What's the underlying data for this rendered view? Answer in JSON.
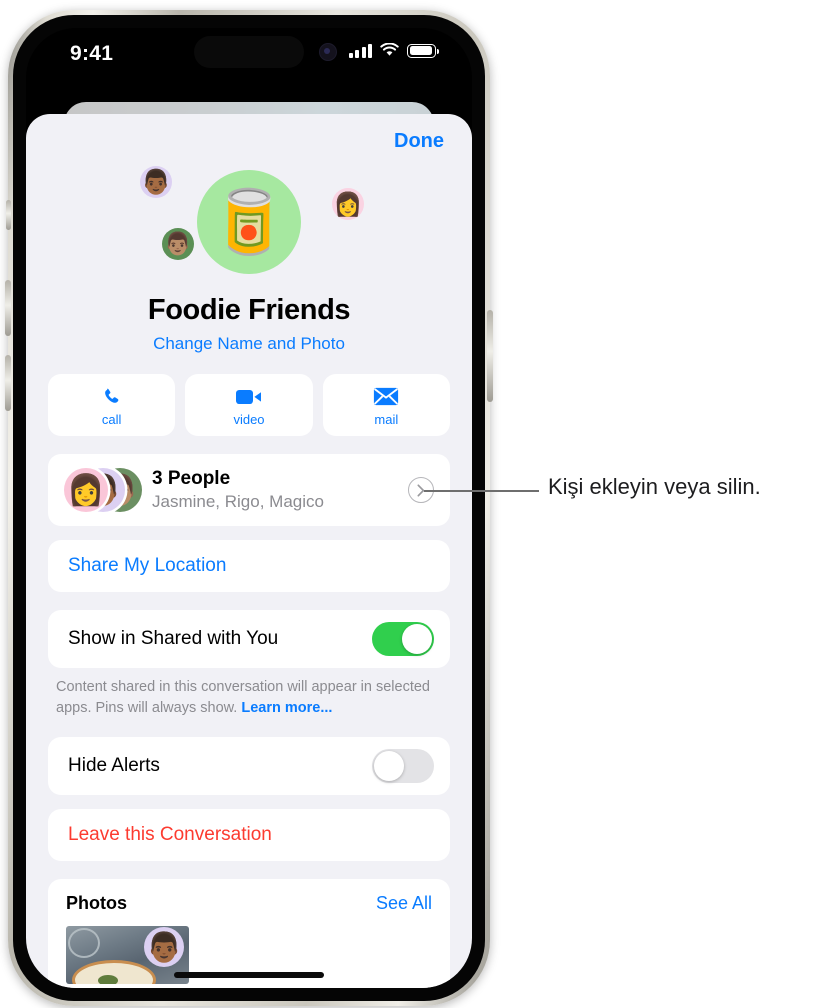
{
  "status_bar": {
    "time": "9:41",
    "cellular_icon": "signal-bars-icon",
    "wifi_icon": "wifi-icon",
    "battery_icon": "battery-icon"
  },
  "sheet": {
    "done_label": "Done",
    "group": {
      "photo_icon": "canned-food-emoji",
      "photo_bg": "#A6E8A0",
      "name": "Foodie Friends",
      "change_link": "Change Name and Photo",
      "member_avatars": [
        {
          "name": "memoji-avatar-purple",
          "glyph": "👨🏾",
          "bg": "#DCD0F2"
        },
        {
          "name": "memoji-avatar-pink",
          "glyph": "👩",
          "bg": "#FAD3E2"
        },
        {
          "name": "photo-avatar-green",
          "glyph": "👨🏽",
          "bg": "#5B8F55"
        }
      ]
    },
    "actions": [
      {
        "label": "call",
        "icon": "phone-icon"
      },
      {
        "label": "video",
        "icon": "video-camera-icon"
      },
      {
        "label": "mail",
        "icon": "envelope-icon"
      }
    ],
    "people_row": {
      "title": "3 People",
      "subtitle": "Jasmine, Rigo, Magico",
      "chevron_icon": "chevron-right-circle-icon",
      "avatars": [
        {
          "name": "avatar-jasmine",
          "glyph": "👩",
          "bg": "#FAC6D8"
        },
        {
          "name": "avatar-rigo",
          "glyph": "👨🏾",
          "bg": "#DCD0F2"
        },
        {
          "name": "avatar-magico",
          "glyph": "👨🏽",
          "bg": "#6B8F62"
        }
      ]
    },
    "share_location_label": "Share My Location",
    "shared_with_you": {
      "label": "Show in Shared with You",
      "toggle_state": "on",
      "toggle_color": "#30CF4D",
      "footnote": "Content shared in this conversation will appear in selected apps. Pins will always show.",
      "footnote_link": "Learn more..."
    },
    "hide_alerts": {
      "label": "Hide Alerts",
      "toggle_state": "off",
      "toggle_color": "#E3E3E6"
    },
    "leave_conversation_label": "Leave this Conversation",
    "leave_conversation_color": "#FC3B30",
    "photos": {
      "title": "Photos",
      "see_all_label": "See All",
      "thumbnail_name": "food-photo-thumbnail",
      "overlay_avatar": "memoji-avatar-purple"
    }
  },
  "callout": {
    "text": "Kişi ekleyin veya silin."
  },
  "theme": {
    "accent_blue": "#0A7CFF",
    "sheet_bg": "#F1F1F6",
    "card_bg": "#FFFFFF",
    "secondary_text": "#8B8B90"
  }
}
